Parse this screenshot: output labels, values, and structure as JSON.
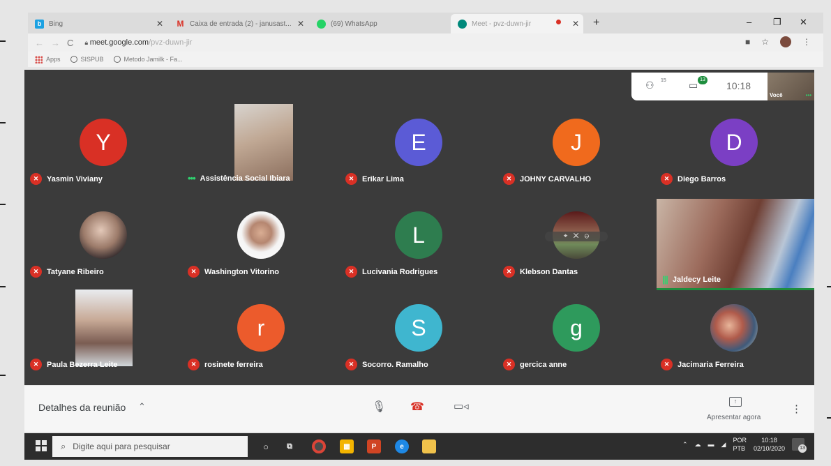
{
  "browser": {
    "tabs": [
      {
        "label": "Bing",
        "icon": "bing-icon",
        "icon_color": "#1ba1e2",
        "glyph": "b"
      },
      {
        "label": "Caixa de entrada (2) - janusast...",
        "icon": "gmail-icon",
        "icon_color": "#d93025",
        "glyph": "M"
      },
      {
        "label": "(69) WhatsApp",
        "icon": "whatsapp-icon",
        "icon_color": "#25d366",
        "glyph": ""
      },
      {
        "label": "Meet - pvz-duwn-jir",
        "icon": "meet-icon",
        "icon_color": "#00897b",
        "glyph": ""
      }
    ],
    "new_tab": "+",
    "window_buttons": {
      "minimize": "–",
      "restore": "❐",
      "close": "✕"
    },
    "url_host": "meet.google.com",
    "url_path": "/pvz-duwn-jir",
    "bookmarks": [
      "Apps",
      "SISPUB",
      "Metodo Jamilk - Fa..."
    ]
  },
  "meet": {
    "people_count": "15",
    "chat_badge": "13",
    "clock": "10:18",
    "self_label": "Você",
    "participants": [
      {
        "name": "Yasmin Viviany",
        "initial": "Y",
        "color": "#d93025",
        "mic": "off",
        "kind": "avatar"
      },
      {
        "name": "Assistência Social Ibiara",
        "initial": "",
        "color": "",
        "mic": "speaking",
        "kind": "video"
      },
      {
        "name": "Erikar Lima",
        "initial": "E",
        "color": "#5b5bd6",
        "mic": "off",
        "kind": "avatar"
      },
      {
        "name": "JOHNY CARVALHO",
        "initial": "J",
        "color": "#f06a1d",
        "mic": "off",
        "kind": "avatar"
      },
      {
        "name": "Diego Barros",
        "initial": "D",
        "color": "#7b3fc4",
        "mic": "off",
        "kind": "avatar"
      },
      {
        "name": "Tatyane Ribeiro",
        "initial": "",
        "color": "",
        "mic": "off",
        "kind": "photo"
      },
      {
        "name": "Washington Vitorino",
        "initial": "",
        "color": "",
        "mic": "off",
        "kind": "photo"
      },
      {
        "name": "Lucivania Rodrigues",
        "initial": "L",
        "color": "#2e7d4f",
        "mic": "off",
        "kind": "avatar"
      },
      {
        "name": "Klebson Dantas",
        "initial": "",
        "color": "",
        "mic": "off",
        "kind": "photo"
      },
      {
        "name": "Jaldecy Leite",
        "initial": "",
        "color": "",
        "mic": "speaking",
        "kind": "video"
      },
      {
        "name": "Paula Bezerra Leite",
        "initial": "",
        "color": "",
        "mic": "off",
        "kind": "video"
      },
      {
        "name": "rosinete ferreira",
        "initial": "r",
        "color": "#ec5b2c",
        "mic": "off",
        "kind": "avatar"
      },
      {
        "name": "Socorro. Ramalho",
        "initial": "S",
        "color": "#3fb6cf",
        "mic": "off",
        "kind": "avatar"
      },
      {
        "name": "gercica anne",
        "initial": "g",
        "color": "#2e9a5c",
        "mic": "off",
        "kind": "avatar"
      },
      {
        "name": "Jacimaria Ferreira",
        "initial": "",
        "color": "",
        "mic": "off",
        "kind": "photo"
      }
    ],
    "bottom": {
      "details": "Detalhes da reunião",
      "present": "Apresentar agora"
    }
  },
  "taskbar": {
    "search_placeholder": "Digite aqui para pesquisar",
    "lang_top": "POR",
    "lang_bottom": "PTB",
    "time": "10:18",
    "date": "02/10/2020",
    "notif_count": "13"
  }
}
